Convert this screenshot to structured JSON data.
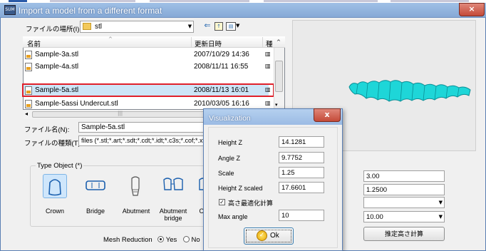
{
  "window": {
    "title": "Import a model from a different format",
    "close_glyph": "×"
  },
  "file_dialog": {
    "look_in_label": "ファイルの場所(I):",
    "look_in_value": "stl",
    "toolbar_icons": [
      "back-arrow-icon",
      "up-folder-icon",
      "view-menu-icon"
    ],
    "columns": {
      "name": "名前",
      "modified": "更新日時",
      "type": "種"
    },
    "files": [
      {
        "name": "Sample-3a.stl",
        "modified": "2007/10/29 14:36",
        "type": "3"
      },
      {
        "name": "Sample-4a.stl",
        "modified": "2008/11/11 16:55",
        "type": "3"
      },
      {
        "name": "Sample-5a.stl",
        "modified": "2008/11/13 16:01",
        "type": "3"
      },
      {
        "name": "Sample-5assi Undercut.stl",
        "modified": "2010/03/05 16:16",
        "type": "3"
      }
    ],
    "selected_index": 2,
    "filename_label": "ファイル名(N):",
    "filename_value": "Sample-5a.stl",
    "filetype_label": "ファイルの種類(T):",
    "filetype_value": "files (*.stl;*.art;*.sdt;*.cdt;*.idt;*.c3s;*.cof;*.xt"
  },
  "type_object": {
    "legend": "Type Object (*)",
    "types": [
      "Crown",
      "Bridge",
      "Abutment",
      "Abutment bridge",
      "O"
    ],
    "selected": "Crown",
    "mesh_reduction_label": "Mesh Reduction",
    "mesh_options": [
      "Yes",
      "No"
    ],
    "mesh_selected": "Yes"
  },
  "right_panel": {
    "field1": "3.00",
    "field2": "1.2500",
    "combo1": "",
    "combo2": "10.00",
    "calc_button": "推定高さ計算"
  },
  "visualization": {
    "title": "Visualization",
    "close_glyph": "x",
    "height_z_label": "Height Z",
    "height_z": "14.1281",
    "angle_z_label": "Angle Z",
    "angle_z": "9.7752",
    "scale_label": "Scale",
    "scale": "1.25",
    "height_z_scaled_label": "Height Z scaled",
    "height_z_scaled": "17.6601",
    "checkbox_label": "高さ最適化計算",
    "checkbox_checked": true,
    "max_angle_label": "Max angle",
    "max_angle": "10",
    "ok_label": "Ok"
  },
  "colors": {
    "accent_red": "#e0202a",
    "model_cyan": "#1ed6d8",
    "title_blue": "#9fc0e6",
    "selection": "#cde5f7"
  }
}
